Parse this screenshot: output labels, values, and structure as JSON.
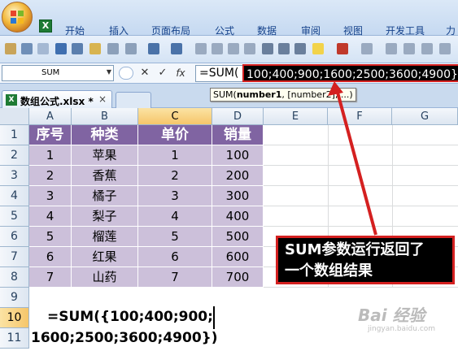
{
  "ribbon": {
    "tabs": [
      "开始",
      "插入",
      "页面布局",
      "公式",
      "数据",
      "审阅",
      "视图",
      "开发工具",
      "力"
    ]
  },
  "formula_bar": {
    "name_box": "SUM",
    "cancel_symbol": "✕",
    "enter_symbol": "✓",
    "fx_symbol": "fx",
    "formula_prefix": "=SUM(",
    "formula_result": "100;400;900;1600;2500;3600;4900}"
  },
  "tooltip": {
    "func": "SUM(",
    "arg1": "number1",
    "rest": ", [number2], ...)"
  },
  "workbook": {
    "name": "数组公式.xlsx *",
    "close": "×"
  },
  "sheet": {
    "columns": [
      "A",
      "B",
      "C",
      "D",
      "E",
      "F",
      "G"
    ],
    "rows": [
      "1",
      "2",
      "3",
      "4",
      "5",
      "6",
      "7",
      "8",
      "9",
      "10",
      "11"
    ],
    "headers": [
      "序号",
      "种类",
      "单价",
      "销量"
    ],
    "data": [
      [
        "1",
        "苹果",
        "1",
        "100"
      ],
      [
        "2",
        "香蕉",
        "2",
        "200"
      ],
      [
        "3",
        "橘子",
        "3",
        "300"
      ],
      [
        "4",
        "梨子",
        "4",
        "400"
      ],
      [
        "5",
        "榴莲",
        "5",
        "500"
      ],
      [
        "6",
        "红果",
        "6",
        "600"
      ],
      [
        "7",
        "山药",
        "7",
        "700"
      ]
    ],
    "formula_line1": "=SUM({100;400;900;",
    "formula_line2": "1600;2500;3600;4900})"
  },
  "callout": {
    "line1": "SUM参数运行返回了",
    "line2": "一个数组结果"
  },
  "watermark": {
    "text": "Bai 经验",
    "sub": "jingyan.baidu.com"
  },
  "colors": {
    "header_fill": "#8064a2",
    "data_fill": "#ccc0da",
    "callout_border": "#d42020",
    "selected_header": "#f6c66a"
  }
}
